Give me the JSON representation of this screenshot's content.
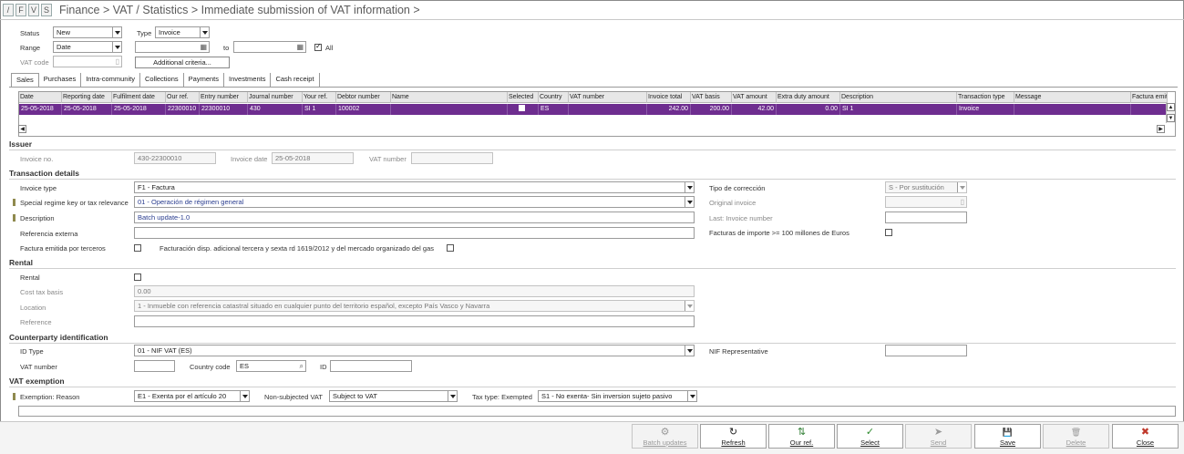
{
  "header": {
    "buttons": [
      "/",
      "F",
      "V",
      "S"
    ],
    "breadcrumb": "Finance > VAT / Statistics > Immediate submission of VAT information >"
  },
  "filters": {
    "status_label": "Status",
    "status_value": "New",
    "type_label": "Type",
    "type_value": "Invoice",
    "range_label": "Range",
    "range_value": "Date",
    "to_label": "to",
    "all_label": "All",
    "vat_code_label": "VAT code",
    "additional_criteria": "Additional criteria..."
  },
  "tabs": [
    "Sales",
    "Purchases",
    "Intra-community",
    "Collections",
    "Payments",
    "Investments",
    "Cash receipt"
  ],
  "grid": {
    "columns": [
      "Date",
      "Reporting date",
      "Fulfilment date",
      "Our ref.",
      "Entry number",
      "Journal number",
      "Your ref.",
      "Debtor number",
      "Name",
      "Selected",
      "Country",
      "VAT number",
      "Invoice total",
      "VAT basis",
      "VAT amount",
      "Extra duty amount",
      "Description",
      "Transaction type",
      "Message",
      "Factura emitid"
    ],
    "row": [
      "25-05-2018",
      "25-05-2018",
      "25-05-2018",
      "22300010",
      "22300010",
      "430",
      "SI 1",
      "100002",
      "",
      "",
      "ES",
      "",
      "242.00",
      "200.00",
      "42.00",
      "0.00",
      "SI 1",
      "Invoice",
      "",
      ""
    ]
  },
  "issuer": {
    "title": "Issuer",
    "invoice_no_label": "Invoice no.",
    "invoice_no_value": "430-22300010",
    "invoice_date_label": "Invoice date",
    "invoice_date_value": "25-05-2018",
    "vat_number_label": "VAT number"
  },
  "transaction": {
    "title": "Transaction details",
    "invoice_type_label": "Invoice type",
    "invoice_type_value": "F1 - Factura",
    "special_regime_label": "Special regime key or tax relevance",
    "special_regime_value": "01 - Operación de régimen general",
    "description_label": "Description",
    "description_value": "Batch update-1.0",
    "referencia_label": "Referencia externa",
    "factura_terceros_label": "Factura emitida por terceros",
    "facturacion_label": "Facturación disp. adicional tercera y sexta rd 1619/2012 y del mercado organizado del gas",
    "tipo_correccion_label": "Tipo de corrección",
    "tipo_correccion_value": "S - Por sustitución",
    "original_invoice_label": "Original invoice",
    "last_invoice_label": "Last: Invoice number",
    "facturas_importe_label": "Facturas de importe >= 100 millones de Euros"
  },
  "rental": {
    "title": "Rental",
    "rental_label": "Rental",
    "cost_tax_label": "Cost tax basis",
    "cost_tax_value": "0.00",
    "location_label": "Location",
    "location_value": "1 - Inmueble con referencia catastral situado en cualquier punto del territorio español, excepto País Vasco y Navarra",
    "reference_label": "Reference"
  },
  "counterparty": {
    "title": "Counterparty identification",
    "id_type_label": "ID Type",
    "id_type_value": "01 - NIF VAT (ES)",
    "vat_number_label": "VAT number",
    "country_code_label": "Country code",
    "country_code_value": "ES",
    "id_label": "ID",
    "nif_rep_label": "NIF Representative"
  },
  "exemption": {
    "title": "VAT exemption",
    "reason_label": "Exemption: Reason",
    "reason_value": "E1 - Exenta por el artículo 20",
    "non_subjected_label": "Non-subjected VAT",
    "non_subjected_value": "Subject to VAT",
    "tax_type_label": "Tax type: Exempted",
    "tax_type_value": "S1 - No exenta- Sin inversion sujeto pasivo"
  },
  "footer": {
    "buttons": [
      {
        "label": "Batch updates",
        "icon": "gear-icon",
        "glyph": "⚙",
        "enabled": false
      },
      {
        "label": "Refresh",
        "icon": "refresh-icon",
        "glyph": "↻",
        "enabled": true
      },
      {
        "label": "Our ref.",
        "icon": "our-ref-icon",
        "glyph": "⇅",
        "enabled": true
      },
      {
        "label": "Select",
        "icon": "check-icon",
        "glyph": "✓",
        "enabled": true
      },
      {
        "label": "Send",
        "icon": "send-icon",
        "glyph": "➤",
        "enabled": false
      },
      {
        "label": "Save",
        "icon": "save-icon",
        "glyph": "💾",
        "enabled": true
      },
      {
        "label": "Delete",
        "icon": "trash-icon",
        "glyph": "🗑",
        "enabled": false
      },
      {
        "label": "Close",
        "icon": "close-icon",
        "glyph": "✖",
        "enabled": true
      }
    ]
  },
  "colors": {
    "selected_row": "#6e2d8f",
    "select_icon": "#2e8b2e",
    "close_icon": "#c0392b"
  }
}
